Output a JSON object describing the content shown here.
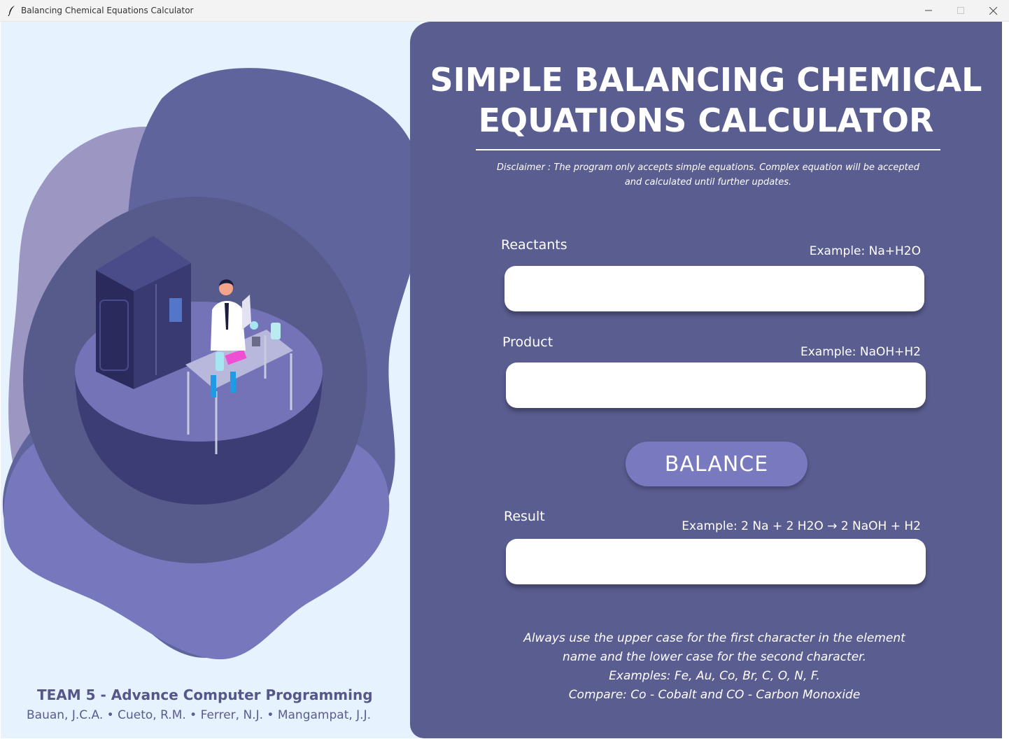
{
  "window": {
    "title": "Balancing Chemical Equations Calculator",
    "app_icon": "feather-icon",
    "controls": [
      "minimize-icon",
      "maximize-icon",
      "close-icon"
    ]
  },
  "left_pane": {
    "illustration": "lab-scientist-illustration",
    "team": "TEAM 5 - Advance Computer Programming",
    "members": "Bauan, J.C.A. • Cueto, R.M. • Ferrer, N.J. • Mangampat, J.J."
  },
  "panel": {
    "heading_line1": "SIMPLE BALANCING CHEMICAL",
    "heading_line2": "EQUATIONS CALCULATOR",
    "disclaimer_line1": "Disclaimer : The program only accepts simple equations. Complex equation will be accepted",
    "disclaimer_line2": "and calculated until further updates.",
    "reactants": {
      "label": "Reactants",
      "example": "Example: Na+H2O",
      "value": ""
    },
    "product": {
      "label": "Product",
      "example": "Example: NaOH+H2",
      "value": ""
    },
    "balance_label": "BALANCE",
    "result": {
      "label": "Result",
      "example": "Example: 2 Na + 2 H2O → 2 NaOH + H2",
      "value": ""
    },
    "notes": [
      "Always use the upper case for the first character in the element",
      "name and the lower case for the second character.",
      "Examples:  Fe, Au, Co, Br, C, O, N, F.",
      "Compare: Co - Cobalt and CO - Carbon Monoxide"
    ]
  },
  "colors": {
    "panel_bg": "#5a5d8f",
    "left_bg": "#e6f2fd",
    "button": "#7879bf"
  }
}
